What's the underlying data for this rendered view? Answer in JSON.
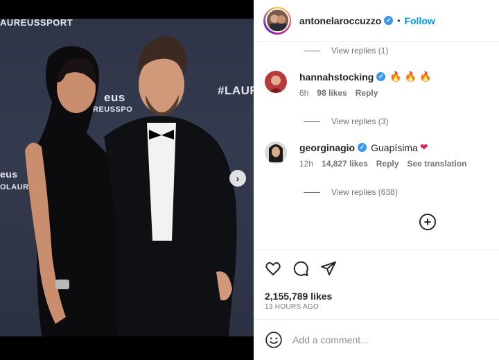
{
  "media": {
    "brand_texts": [
      "AUREUSSPORT",
      "#LAUR",
      "eus",
      "REUSSPO",
      "eus",
      "OLAUR"
    ],
    "carousel": {
      "count": 3,
      "active": 0
    }
  },
  "header": {
    "username": "antonelaroccuzzo",
    "separator": "•",
    "follow_label": "Follow"
  },
  "comments": {
    "reply_1": "View replies (1)",
    "c1": {
      "user": "hannahstocking",
      "text": "🔥 🔥 🔥",
      "time": "6h",
      "likes": "98 likes",
      "reply": "Reply"
    },
    "reply_2": "View replies (3)",
    "c2": {
      "user": "georginagio",
      "text": "Guapísima",
      "emoji": "❤",
      "time": "12h",
      "likes": "14,827 likes",
      "reply": "Reply",
      "translate": "See translation"
    },
    "reply_3": "View replies (638)"
  },
  "post": {
    "likes": "2,155,789 likes",
    "time": "13 HOURS AGO"
  },
  "composer": {
    "placeholder": "Add a comment..."
  },
  "colors": {
    "accent": "#0095f6",
    "verified": "#3897f0"
  }
}
